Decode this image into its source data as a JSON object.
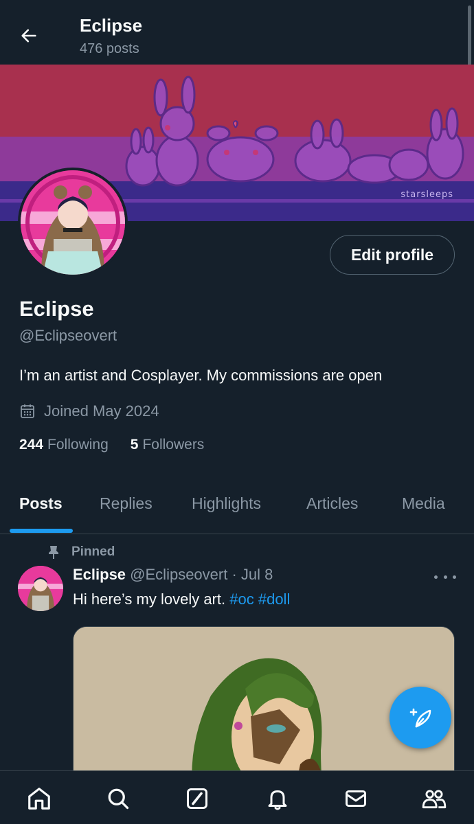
{
  "header": {
    "title": "Eclipse",
    "subtitle": "476 posts"
  },
  "banner": {
    "signature": "starsleeps",
    "colors": {
      "pink": "#a8304e",
      "purple": "#8e3a9a",
      "blue": "#3b2a8a"
    }
  },
  "profile": {
    "edit_button": "Edit profile",
    "name": "Eclipse",
    "handle": "@Eclipseovert",
    "bio": "I’m an artist and Cosplayer. My commissions are open",
    "joined": "Joined May 2024",
    "following_count": "244",
    "following_label": "Following",
    "followers_count": "5",
    "followers_label": "Followers"
  },
  "tabs": [
    {
      "label": "Posts",
      "active": true
    },
    {
      "label": "Replies"
    },
    {
      "label": "Highlights"
    },
    {
      "label": "Articles"
    },
    {
      "label": "Media"
    }
  ],
  "post": {
    "pinned_label": "Pinned",
    "author_name": "Eclipse",
    "meta": "@Eclipseovert · Jul 8",
    "text": "Hi here’s my lovely art.",
    "hashtags": [
      "#oc",
      "#doll"
    ]
  },
  "icons": {
    "back": "arrow-left-icon",
    "calendar": "calendar-icon",
    "pin": "pin-icon",
    "more": "more-horizontal-icon",
    "compose": "compose-post-icon",
    "nav": [
      "home-icon",
      "search-icon",
      "grok-icon",
      "notifications-icon",
      "messages-icon",
      "communities-icon"
    ]
  },
  "theme": {
    "background": "#15202b",
    "accent": "#1d9bf0",
    "secondary_text": "#8b98a5"
  }
}
